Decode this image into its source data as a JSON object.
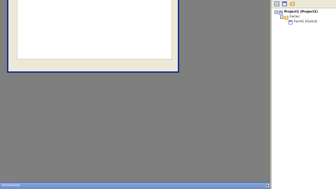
{
  "workspace": {
    "form_window": {}
  },
  "project_explorer": {
    "toolbar": {
      "icons": [
        "view-code-icon",
        "view-object-icon",
        "toggle-folders-icon"
      ]
    },
    "tree": {
      "project_label": "Project1 (Project1)",
      "forms_folder_label": "Forms",
      "form1_label": "Form1 (Form1)"
    }
  },
  "status_bar": {
    "text": "Immediate"
  },
  "colors": {
    "workspace_bg": "#808080",
    "form_border": "#1a2f8f",
    "form_bg": "#ece9d8",
    "status_bar_bg": "#6f8cc8"
  }
}
